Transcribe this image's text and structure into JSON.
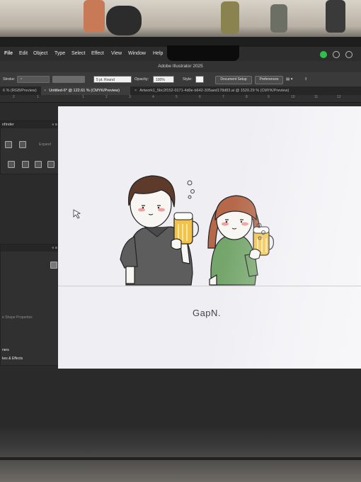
{
  "menubar": {
    "items": [
      "File",
      "Edit",
      "Object",
      "Type",
      "Select",
      "Effect",
      "View",
      "Window",
      "Help"
    ]
  },
  "window": {
    "title": "Adobe Illustrator 2025"
  },
  "control_bar": {
    "stroke_label": "Stroke:",
    "brush_value": "5 pt. Round",
    "opacity_label": "Opacity:",
    "opacity_value": "100%",
    "style_label": "Style:",
    "document_setup": "Document Setup",
    "preferences": "Preferences"
  },
  "tabs": [
    {
      "label": "6 % (RGB/Preview)"
    },
    {
      "label": "Untitled-6* @ 122.61 % (CMYK/Preview)",
      "active": true
    },
    {
      "label": "Artwork1_5bc2f152-0171-4d0e-b642-305aed178d83.ai @ 1520.29 % (CMYK/Preview)"
    }
  ],
  "ruler": [
    "2",
    "1",
    "1",
    "2",
    "3",
    "4",
    "5",
    "6",
    "7",
    "8",
    "9",
    "10",
    "11",
    "12"
  ],
  "panels": {
    "pathfinder_title": "nfinder",
    "expand_label": "Expand",
    "shape_props": "e Shape Properties",
    "ners_label": "ners",
    "strokes_effects": "kes & Effects"
  },
  "artwork": {
    "brand_text": "GapN."
  },
  "colors": {
    "artboard": "#eeeef3",
    "shirt_gray": "#5d5d5d",
    "shirt_green": "#74a56a",
    "hair_brown": "#5d3a2a",
    "hair_orange": "#b5684a",
    "beer": "#f2c24a"
  }
}
